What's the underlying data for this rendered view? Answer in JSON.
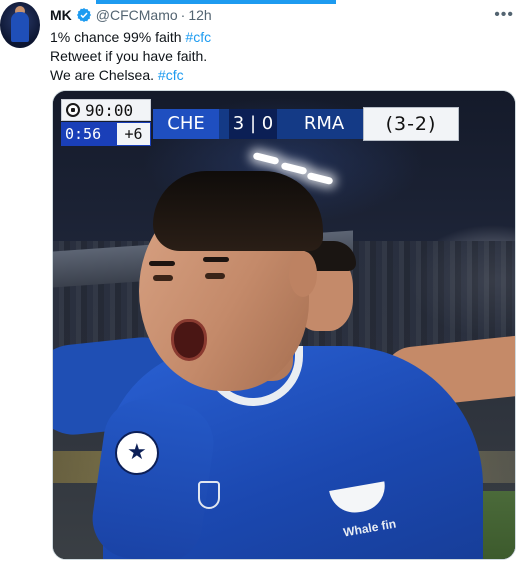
{
  "tweet": {
    "author_name": "MK",
    "handle": "@CFCMamo",
    "separator": "·",
    "time": "12h",
    "more_label": "•••",
    "lines": [
      {
        "text": "1% chance 99% faith ",
        "hashtag": "#cfc"
      },
      {
        "text": "Retweet if you have faith.",
        "hashtag": ""
      },
      {
        "text": "We are Chelsea. ",
        "hashtag": "#cfc"
      }
    ]
  },
  "media": {
    "scoreboard": {
      "clock": "90:00",
      "added_clock": "0:56",
      "added_time": "+6",
      "home_team": "CHE",
      "score": "3 | 0",
      "away_team": "RMA",
      "aggregate": "(3-2)"
    },
    "sponsor_text": "Whale fin"
  },
  "colors": {
    "link": "#1d9bf0",
    "verified": "#1d9bf0",
    "text": "#0f1419",
    "muted": "#536471",
    "chelsea_blue": "#1f4fc0"
  }
}
